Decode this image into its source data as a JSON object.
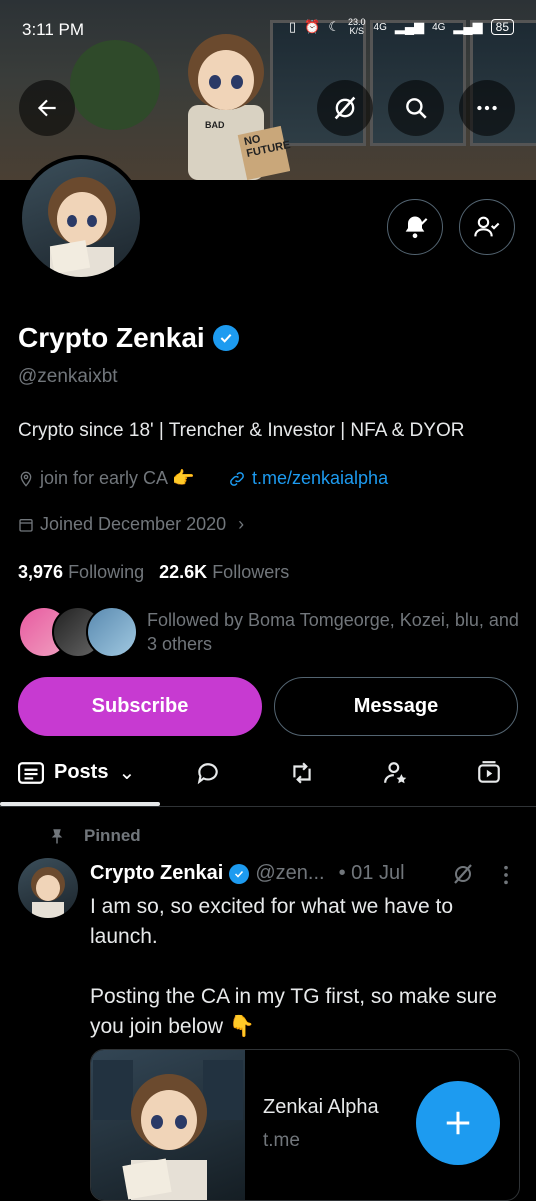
{
  "status_bar": {
    "time": "3:11 PM",
    "speed": "23.0",
    "speed_unit": "K/S",
    "net1": "4G",
    "net2": "4G",
    "battery": "85"
  },
  "banner": {
    "sign_text": "NO FUTURE",
    "shirt_text": "BAD"
  },
  "profile": {
    "name": "Crypto Zenkai",
    "handle": "@zenkaixbt",
    "bio": "Crypto since 18' | Trencher & Investor | NFA & DYOR",
    "location": "join for early CA 👉",
    "link": "t.me/zenkaialpha",
    "joined": "Joined December 2020",
    "following_count": "3,976",
    "following_label": "Following",
    "followers_count": "22.6K",
    "followers_label": "Followers",
    "followed_by": "Followed by Boma Tomgeorge, Kozei, blu, and 3 others"
  },
  "actions": {
    "subscribe": "Subscribe",
    "message": "Message"
  },
  "tabs": {
    "posts": "Posts"
  },
  "post": {
    "pinned": "Pinned",
    "name": "Crypto Zenkai",
    "handle": "@zen...",
    "date": "• 01 Jul",
    "text": "I am so, so excited for what we have to launch.\n\nPosting the CA in my TG first, so make sure you join below 👇",
    "card_title": "Zenkai Alpha",
    "card_domain": "t.me"
  },
  "colors": {
    "accent": "#1d9bf0",
    "subscribe": "#c73ad1",
    "muted": "#71767b"
  }
}
